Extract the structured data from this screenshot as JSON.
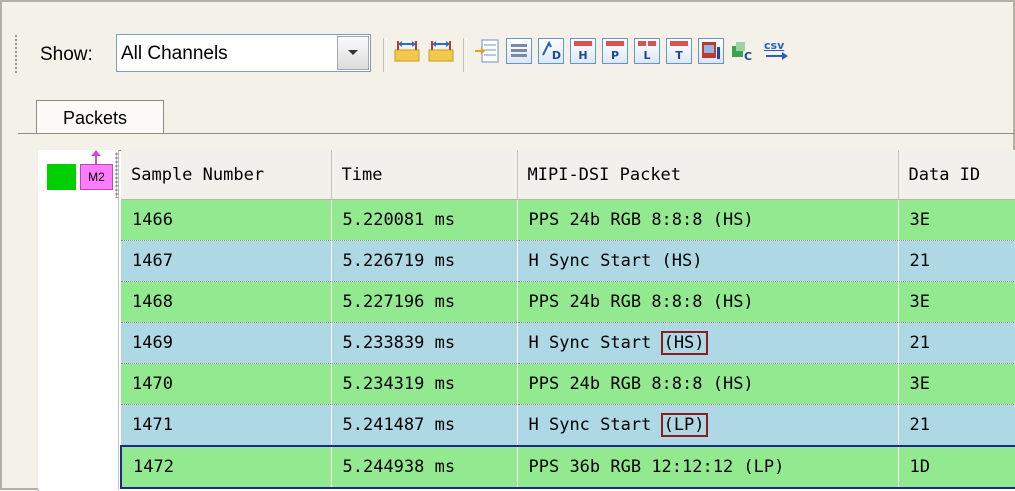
{
  "toolbar": {
    "show_label": "Show:",
    "channel_select": {
      "value": "All Channels"
    },
    "icons": [
      "prev-marker-icon",
      "next-marker-icon",
      "insert-column-icon",
      "packet-view-icon",
      "decode-d-icon",
      "decode-h-icon",
      "decode-p-icon",
      "decode-l-icon",
      "decode-t-icon",
      "decode-image-icon",
      "decode-c-icon",
      "export-csv-icon"
    ],
    "boxed_letters": {
      "d": "D",
      "h": "H",
      "p": "P",
      "l": "L",
      "t": "T",
      "c": "C"
    },
    "csv_label": "csv"
  },
  "tabs": [
    {
      "label": "Packets",
      "active": true
    }
  ],
  "markers": {
    "m2_label": "M2"
  },
  "table": {
    "columns": [
      "Sample Number",
      "Time",
      "MIPI-DSI Packet",
      "Data ID"
    ],
    "rows": [
      {
        "sample": "1466",
        "time": "5.220081 ms",
        "packet": "PPS 24b RGB 8:8:8 (HS)",
        "packet_main": "PPS 24b RGB 8:8:8 (HS)",
        "mode": "",
        "data_id": "3E",
        "color": "green"
      },
      {
        "sample": "1467",
        "time": "5.226719 ms",
        "packet": "H Sync Start (HS)",
        "packet_main": "H Sync Start (HS)",
        "mode": "",
        "data_id": "21",
        "color": "blue"
      },
      {
        "sample": "1468",
        "time": "5.227196 ms",
        "packet": "PPS 24b RGB 8:8:8 (HS)",
        "packet_main": "PPS 24b RGB 8:8:8 (HS)",
        "mode": "",
        "data_id": "3E",
        "color": "green"
      },
      {
        "sample": "1469",
        "time": "5.233839 ms",
        "packet": "H Sync Start (HS)",
        "packet_main": "H Sync Start",
        "mode": "(HS)",
        "data_id": "21",
        "color": "blue"
      },
      {
        "sample": "1470",
        "time": "5.234319 ms",
        "packet": "PPS 24b RGB 8:8:8 (HS)",
        "packet_main": "PPS 24b RGB 8:8:8 (HS)",
        "mode": "",
        "data_id": "3E",
        "color": "green"
      },
      {
        "sample": "1471",
        "time": "5.241487 ms",
        "packet": "H Sync Start (LP)",
        "packet_main": "H Sync Start",
        "mode": "(LP)",
        "data_id": "21",
        "color": "blue"
      },
      {
        "sample": "1472",
        "time": "5.244938 ms",
        "packet": "PPS 36b RGB 12:12:12 (LP)",
        "packet_main": "PPS 36b RGB 12:12:12 (LP)",
        "mode": "",
        "data_id": "1D",
        "color": "green",
        "selected": true
      }
    ]
  },
  "colors": {
    "row_green": "#93e98f",
    "row_blue": "#add8e4",
    "highlight_box": "#8b1e24",
    "selection": "#1a2a8a",
    "marker_green": "#00d000",
    "marker_m2": "#ff7cff"
  }
}
